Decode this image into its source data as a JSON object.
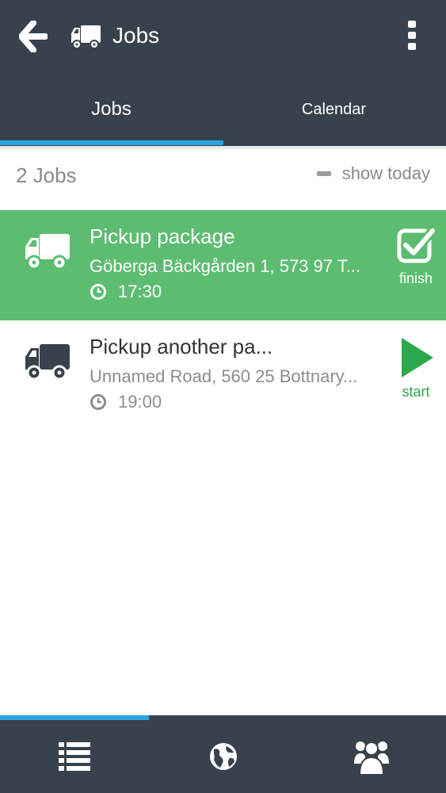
{
  "toolbar": {
    "title": "Jobs",
    "back_icon": "arrow-left-icon",
    "logo_icon": "truck-icon",
    "menu_icon": "more-vert-icon"
  },
  "tabs": [
    {
      "label": "Jobs",
      "selected": true
    },
    {
      "label": "Calendar",
      "selected": false
    }
  ],
  "list_header": {
    "count": "2 Jobs",
    "show_today": "show today"
  },
  "jobs": [
    {
      "title": "Pickup package",
      "address": "Göberga Bäckgården 1, 573 97 T...",
      "time": "17:30",
      "action": "finish",
      "action_icon": "check-square-icon",
      "highlighted": true
    },
    {
      "title": "Pickup another pa...",
      "address": "Unnamed Road, 560 25 Bottnary...",
      "time": "19:00",
      "action": "start",
      "action_icon": "play-icon",
      "highlighted": false
    }
  ],
  "bottom_nav": [
    {
      "icon": "list-icon",
      "selected": true
    },
    {
      "icon": "globe-icon",
      "selected": false
    },
    {
      "icon": "users-icon",
      "selected": false
    }
  ],
  "colors": {
    "app_bar": "#37424c",
    "accent": "#2aa5de",
    "active_row": "#5cbd71",
    "start_green": "#2da84a"
  }
}
